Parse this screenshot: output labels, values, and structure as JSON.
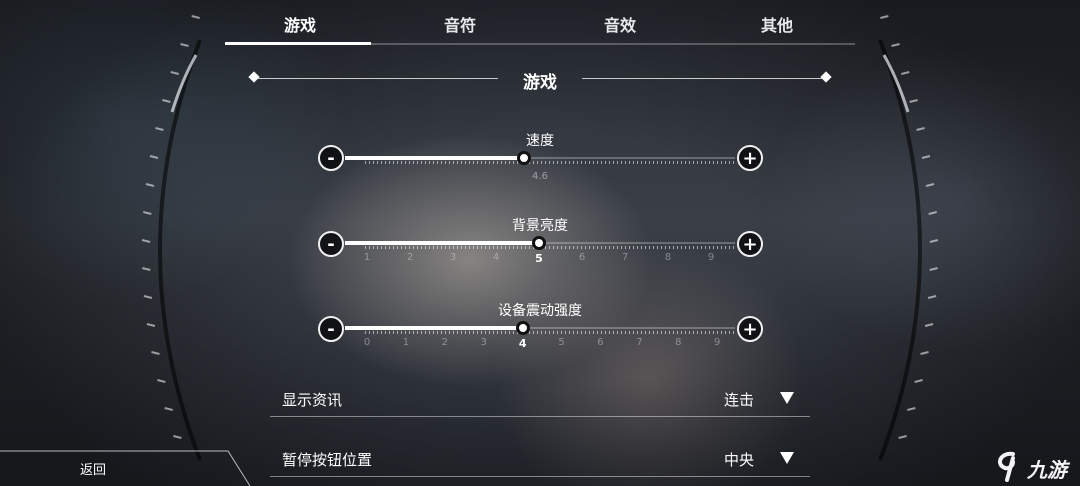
{
  "tabs": [
    {
      "label": "游戏",
      "active": true
    },
    {
      "label": "音符",
      "active": false
    },
    {
      "label": "音效",
      "active": false
    },
    {
      "label": "其他",
      "active": false
    }
  ],
  "section": {
    "title": "游戏"
  },
  "sliders": {
    "speed": {
      "label": "速度",
      "value": "4.6",
      "fraction": 0.46
    },
    "brightness": {
      "label": "背景亮度",
      "value": 5,
      "ticks": [
        "1",
        "2",
        "3",
        "4",
        "5",
        "6",
        "7",
        "8",
        "9"
      ]
    },
    "vibration": {
      "label": "设备震动强度",
      "value": 4,
      "ticks": [
        "0",
        "1",
        "2",
        "3",
        "4",
        "5",
        "6",
        "7",
        "8",
        "9"
      ]
    }
  },
  "buttons": {
    "minus": "-",
    "plus": "+"
  },
  "rows": [
    {
      "label": "显示资讯",
      "value": "连击"
    },
    {
      "label": "暂停按钮位置",
      "value": "中央"
    }
  ],
  "back": {
    "label": "返回"
  },
  "watermark": {
    "text": "九游"
  },
  "colors": {
    "accent": "#ffffff",
    "track": "#5a5f66"
  }
}
